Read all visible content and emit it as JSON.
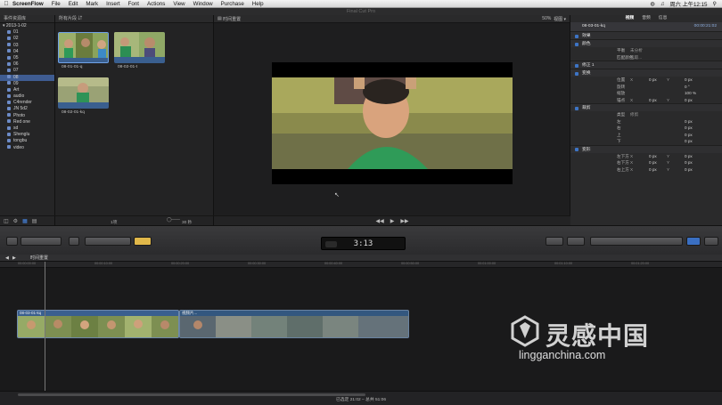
{
  "menubar": {
    "app": "ScreenFlow",
    "items": [
      "File",
      "Edit",
      "Mark",
      "Insert",
      "Font",
      "Actions",
      "View",
      "Window",
      "Purchase",
      "Help"
    ],
    "clock": "周六 上午12:15"
  },
  "titlebar": {
    "title": "Final Cut Pro"
  },
  "library": {
    "header": "事件资源库",
    "root": "2013-1-02",
    "events": [
      "01",
      "02",
      "03",
      "04",
      "05",
      "06",
      "07",
      "08",
      "09",
      "Art",
      "audio",
      "C4render",
      "JN 5d2",
      "Photo",
      "Red one",
      "sd",
      "Shenglu",
      "tongbu",
      "video"
    ],
    "selected": "08"
  },
  "browser": {
    "header": "所有片段",
    "clips": [
      {
        "label": "08-01-01-q"
      },
      {
        "label": "08-02-01-t"
      },
      {
        "label": "08-02-01-kq"
      }
    ],
    "footer_count": "1项",
    "footer_zoom": "30 秒"
  },
  "viewer": {
    "title": "时间重置",
    "zoom": "50%"
  },
  "inspector": {
    "tabs": [
      "视频",
      "音频",
      "信息"
    ],
    "clip_name": "08-03-01-kq",
    "duration": "00:00:21:02",
    "sections": [
      {
        "name": "效果",
        "props": []
      },
      {
        "name": "颜色",
        "props": [
          {
            "label": "平衡",
            "axis": "未分析"
          },
          {
            "label": "匹配颜色",
            "axis": "选取..."
          }
        ]
      },
      {
        "name": "修正 1",
        "props": []
      },
      {
        "name": "变换",
        "props": [
          {
            "label": "位置",
            "axis": "X",
            "v1": "0 px",
            "ax2": "Y",
            "v2": "0 px"
          },
          {
            "label": "旋转",
            "axis": "",
            "v1": "",
            "ax2": "",
            "v2": "0 °"
          },
          {
            "label": "缩放",
            "axis": "",
            "v1": "",
            "ax2": "",
            "v2": "100 %"
          },
          {
            "label": "锚点",
            "axis": "X",
            "v1": "0 px",
            "ax2": "Y",
            "v2": "0 px"
          }
        ]
      },
      {
        "name": "裁剪",
        "props": [
          {
            "label": "类型",
            "axis": "修剪",
            "v1": "",
            "ax2": "",
            "v2": ""
          },
          {
            "label": "左",
            "axis": "",
            "v1": "",
            "ax2": "",
            "v2": "0 px"
          },
          {
            "label": "右",
            "axis": "",
            "v1": "",
            "ax2": "",
            "v2": "0 px"
          },
          {
            "label": "上",
            "axis": "",
            "v1": "",
            "ax2": "",
            "v2": "0 px"
          },
          {
            "label": "下",
            "axis": "",
            "v1": "",
            "ax2": "",
            "v2": "0 px"
          }
        ]
      },
      {
        "name": "变形",
        "props": [
          {
            "label": "左下方",
            "axis": "X",
            "v1": "0 px",
            "ax2": "Y",
            "v2": "0 px"
          },
          {
            "label": "右下方",
            "axis": "X",
            "v1": "0 px",
            "ax2": "Y",
            "v2": "0 px"
          },
          {
            "label": "右上方",
            "axis": "X",
            "v1": "0 px",
            "ax2": "Y",
            "v2": "0 px"
          }
        ]
      }
    ]
  },
  "toolbar": {
    "timecode": "3:13"
  },
  "timeline": {
    "title": "时间重置",
    "ticks": [
      "00:00:00:00",
      "00:00:10:00",
      "00:00:20:00",
      "00:00:30:00",
      "00:00:40:00",
      "00:00:50:00",
      "00:01:00:00",
      "00:01:10:00",
      "00:01:20:00"
    ],
    "clips": [
      {
        "label": "08-03-01-kq"
      },
      {
        "label": "视频片..."
      }
    ],
    "status": "已选定 21:02 – 总共 51:06"
  },
  "watermark": {
    "cn": "灵感中国",
    "url": "lingganchina.com"
  },
  "colors": {
    "accent": "#3d74c5",
    "selected": "#3f5c91",
    "clip_blue": "#3a5f8f"
  }
}
